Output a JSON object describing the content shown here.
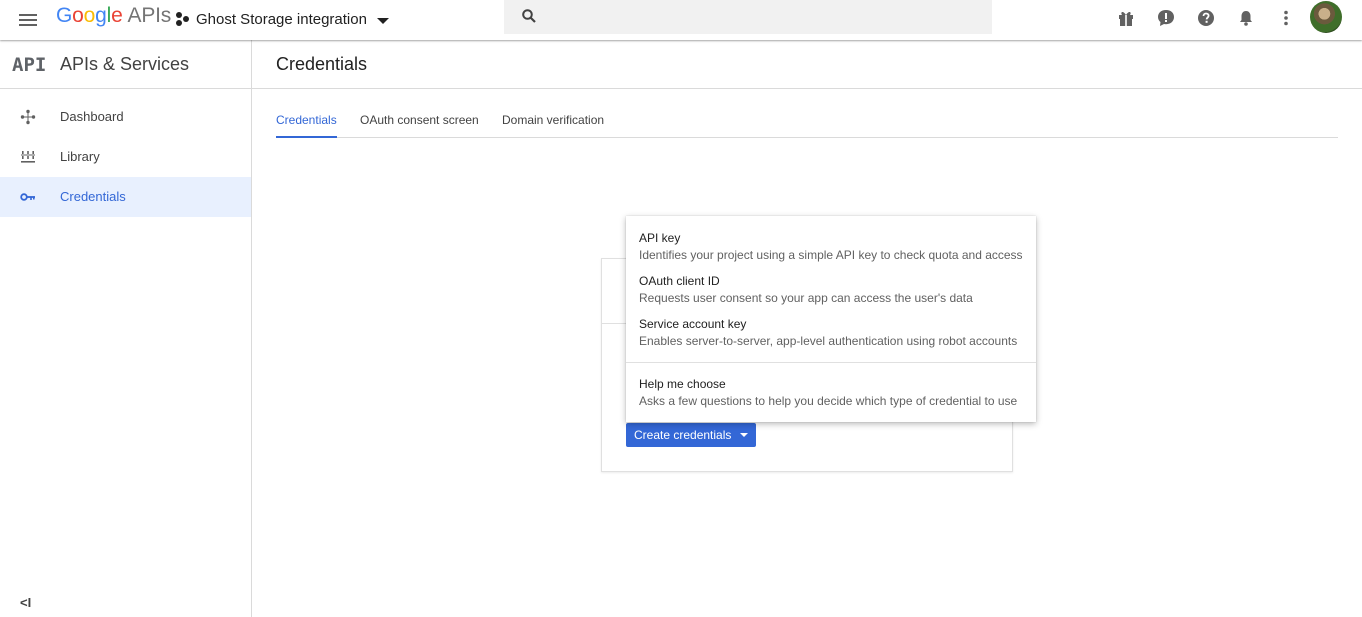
{
  "header": {
    "logo_google": "Google",
    "logo_apis": "APIs",
    "project_name": "Ghost Storage integration",
    "search_placeholder": "",
    "icons": [
      "menu-icon",
      "gift-icon",
      "feedback-icon",
      "help-icon",
      "notifications-icon",
      "more-vert-icon"
    ]
  },
  "sidebar": {
    "api_mark": "API",
    "title": "APIs & Services",
    "items": [
      {
        "label": "Dashboard",
        "icon": "dashboard-icon"
      },
      {
        "label": "Library",
        "icon": "library-icon"
      },
      {
        "label": "Credentials",
        "icon": "key-icon",
        "active": true
      }
    ],
    "collapse_label": "<I"
  },
  "main": {
    "page_title": "Credentials",
    "tabs": [
      {
        "label": "Credentials",
        "active": true
      },
      {
        "label": "OAuth consent screen"
      },
      {
        "label": "Domain verification"
      }
    ],
    "create_button_label": "Create credentials"
  },
  "menu": {
    "items": [
      {
        "title": "API key",
        "description": "Identifies your project using a simple API key to check quota and access"
      },
      {
        "title": "OAuth client ID",
        "description": "Requests user consent so your app can access the user's data"
      },
      {
        "title": "Service account key",
        "description": "Enables server-to-server, app-level authentication using robot accounts"
      },
      {
        "title": "Help me choose",
        "description": "Asks a few questions to help you decide which type of credential to use"
      }
    ]
  },
  "colors": {
    "accent": "#3367d6",
    "active_nav_bg": "#e8f0fe",
    "search_bg": "#f1f1f1"
  }
}
